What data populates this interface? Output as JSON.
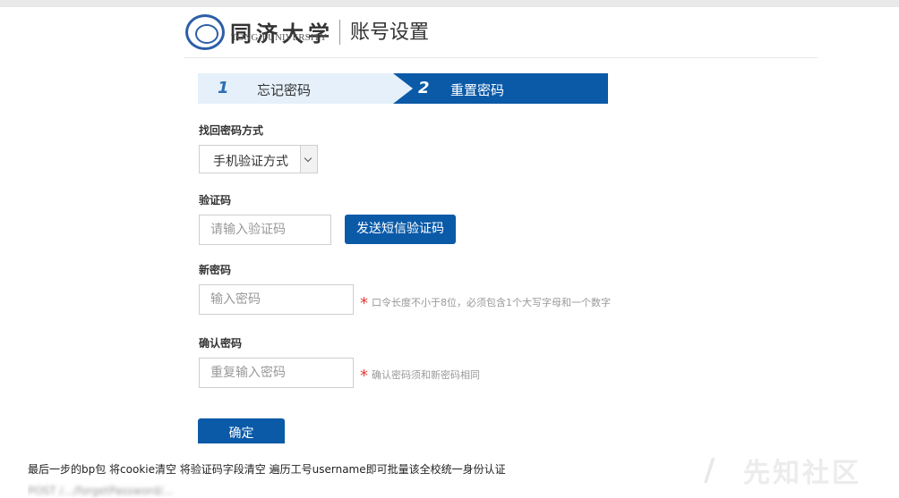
{
  "header": {
    "logo_cn": "同济大学",
    "logo_en": "TONGJI UNIVERSITY",
    "title": "账号设置"
  },
  "steps": [
    {
      "num": "1",
      "label": "忘记密码"
    },
    {
      "num": "2",
      "label": "重置密码"
    }
  ],
  "form": {
    "method_label": "找回密码方式",
    "method_value": "手机验证方式",
    "code_label": "验证码",
    "code_placeholder": "请输入验证码",
    "send_button": "发送短信验证码",
    "new_label": "新密码",
    "new_placeholder": "输入密码",
    "new_hint": "口令长度不小于8位，必须包含1个大写字母和一个数字",
    "confirm_label": "确认密码",
    "confirm_placeholder": "重复输入密码",
    "confirm_hint": "确认密码须和新密码相同",
    "submit_button": "确定",
    "required_mark": "*"
  },
  "caption": {
    "line1": "最后一步的bp包 将cookie清空 将验证码字段清空 遍历工号username即可批量该全校统一身份认证",
    "line2": "POST /.../forgetPassword/...",
    "watermark": "先知社区"
  },
  "colors": {
    "primary": "#0a5aa8",
    "step_inactive": "#e5f0fa",
    "required": "#e53935"
  }
}
